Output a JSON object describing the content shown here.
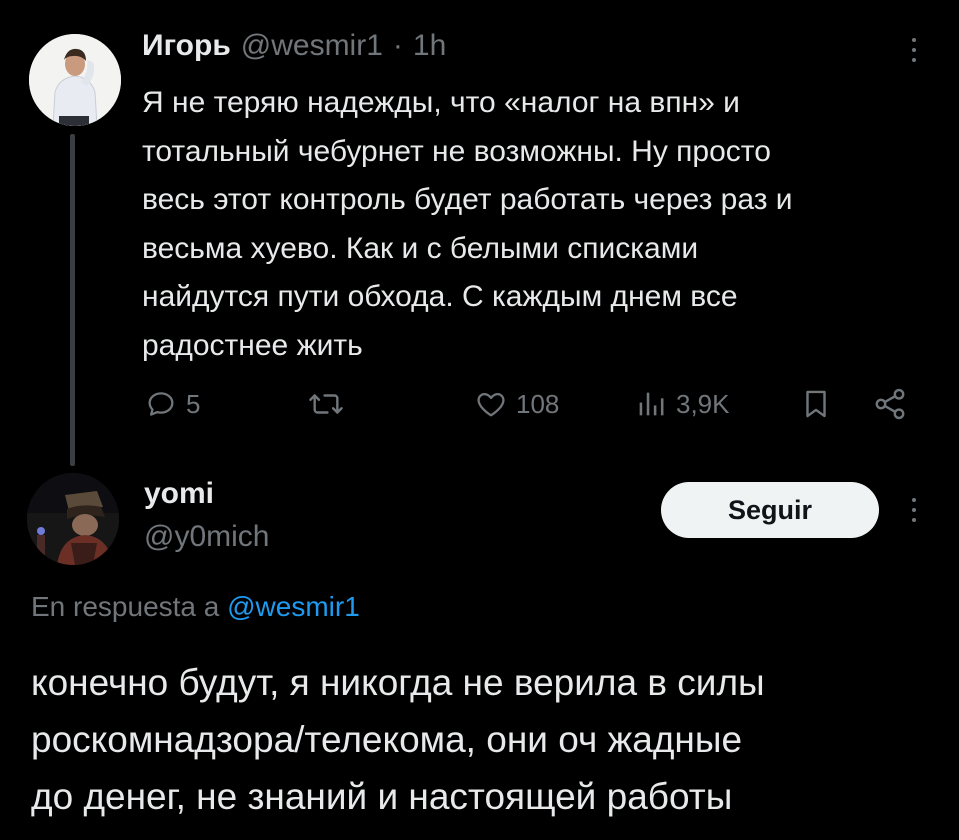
{
  "tweet": {
    "author_name": "Игорь",
    "author_handle": "@wesmir1",
    "separator": "·",
    "time": "1h",
    "text_lines": [
      "Я не теряю надежды, что «налог на впн» и",
      "тотальный чебурнет не возможны. Ну просто",
      "весь этот контроль будет работать через раз и",
      "весьма хуево. Как и с белыми списками",
      "найдутся пути обхода. С каждым днем все",
      "радостнее жить"
    ],
    "stats": {
      "replies": "5",
      "likes": "108",
      "views": "3,9K"
    },
    "icons": {
      "reply": "reply-icon",
      "retweet": "retweet-icon",
      "like": "heart-icon",
      "views": "analytics-icon",
      "bookmark": "bookmark-icon",
      "share": "share-icon",
      "menu": "more-vertical-icon"
    }
  },
  "reply": {
    "author_name": "yomi",
    "author_handle": "@y0mich",
    "follow_label": "Seguir",
    "replying_to_prefix": "En respuesta a",
    "replying_to_handle": "@wesmir1",
    "text_lines": [
      "конечно будут, я никогда не верила в силы",
      "роскомнадзора/телекома, они оч жадные",
      "до денег, не знаний и настоящей работы"
    ]
  },
  "colors": {
    "background": "#000000",
    "text_primary": "#e7e9ea",
    "text_muted": "#71767b",
    "link": "#1d9bf0",
    "thread_line": "#3b3f43",
    "follow_button": "#eff3f4"
  }
}
